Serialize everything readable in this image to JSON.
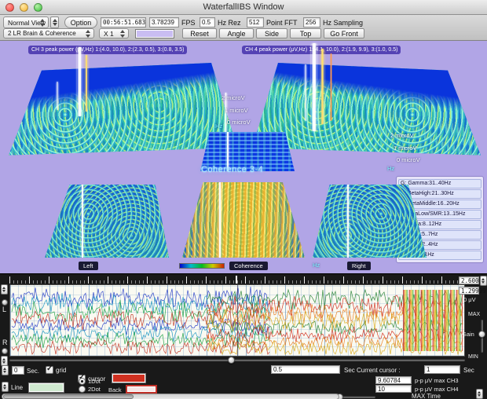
{
  "window": {
    "title": "WaterfallIBS Window"
  },
  "toolbar": {
    "view_popup": "Normal View",
    "option_button": "Option",
    "time_display": "00:56:51.683",
    "fps_value": "3.78239",
    "fps_label": "FPS",
    "rez_value": "0.5",
    "rez_label": "Hz Rez",
    "fft_value": "512",
    "fft_label": "Point FFT",
    "sampling_value": "256",
    "sampling_label": "Hz Sampling",
    "mode_popup": "2 LR Brain & Coherence",
    "x_popup": "X 1",
    "swatch_color": "#c9bdf2",
    "reset_button": "Reset",
    "angle_button": "Angle",
    "side_button": "Side",
    "top_button": "Top",
    "front_button": "Go Front"
  },
  "viz": {
    "background_color": "#b1a5e6",
    "ch3_peak_label": "CH 3 peak power (μV,Hz) 1:(4.0, 10.0), 2:(2.3, 0.5), 3:(0.8, 3.5)",
    "ch4_peak_label": "CH 4 peak power (μV,Hz) 1:(4.1, 10.0), 2:(1.9, 9.9), 3:(1.0, 0.5)",
    "coherence_title": "Coherence 3-4",
    "axis_labels": [
      "2 microV",
      "1 microV",
      "0 microV"
    ],
    "hz_label": "Hz",
    "panel_labels": {
      "left": "Left",
      "center": "Coherence",
      "right": "Right"
    },
    "legend": [
      "G: Gamma:31..40Hz",
      "H: BetaHigh:21..30Hz",
      "M: BetaMiddle:16..20Hz",
      "L: BetaLow/SMR:13..15Hz",
      "A: Alpha:8..12Hz",
      "T: Theta:5..7Hz",
      "D: Delta:2..4Hz",
      "B: Eye:0..1Hz"
    ]
  },
  "scope": {
    "left_label": "L",
    "right_label": "R",
    "gain_top_value": "2.60000",
    "gain_mid_value": "1.29999",
    "zero_uv_label": "0 μV",
    "max_label": "MAX",
    "gain_label": "Gain",
    "min_label": "MIN",
    "trace_colors_left": [
      "#2038c8",
      "#1090c0",
      "#18a040",
      "#c03020"
    ],
    "trace_colors_right": [
      "#208030",
      "#d02818",
      "#e87818",
      "#d8a818"
    ]
  },
  "controls": {
    "sec_value": "0",
    "sec_label": "Sec.",
    "grid_label": "grid",
    "cursor_label": "cursor",
    "cursor_swatch_color": "#d03020",
    "line_label": "Line",
    "line_swatch_color": "#cfe9cf",
    "dot1_label": "1Dot",
    "dot2_label": "2Dot",
    "back_label": "Back",
    "back_swatch_color": "#f6e6e6",
    "current_cursor_value": "0.5",
    "current_cursor_label": "Sec Current cursor :",
    "cursor_sec_value": "1",
    "cursor_sec_unit": "Sec",
    "pp_ch3_value": "9.60784",
    "pp_ch3_label": "p-p μV max CH3",
    "pp_ch4_value": "10",
    "pp_ch4_label": "p-p μV max CH4",
    "max_time_label": "MAX Time"
  }
}
